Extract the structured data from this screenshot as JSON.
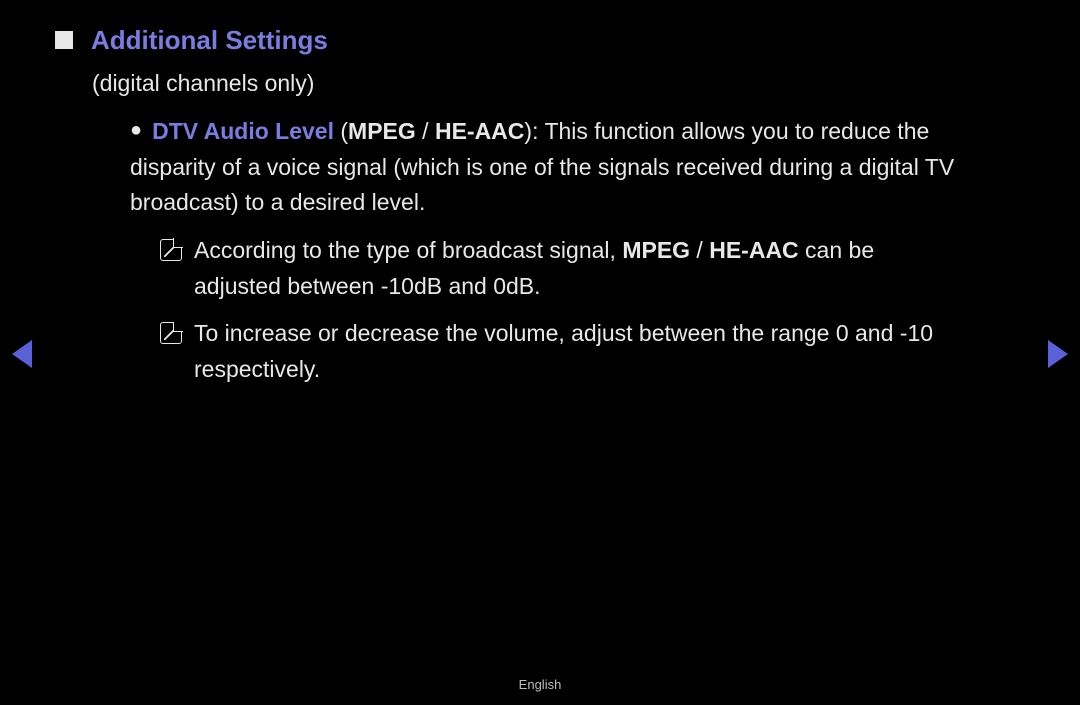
{
  "heading": {
    "title": "Additional Settings",
    "subtitle": "(digital channels only)"
  },
  "item": {
    "label": "DTV Audio Level",
    "open_paren": " (",
    "opt1": "MPEG",
    "sep": " / ",
    "opt2": "HE-AAC",
    "close_paren": ")",
    "colon": ": ",
    "description": "This function allows you to reduce the disparity of a voice signal (which is one of the signals received during a digital TV broadcast) to a desired level."
  },
  "note1": {
    "pre": "According to the type of broadcast signal, ",
    "opt1": "MPEG",
    "sep": " / ",
    "opt2": "HE-AAC",
    "post": " can be adjusted between -10dB and 0dB."
  },
  "note2": {
    "text": "To increase or decrease the volume, adjust between the range 0 and -10 respectively."
  },
  "footer": {
    "language": "English"
  }
}
